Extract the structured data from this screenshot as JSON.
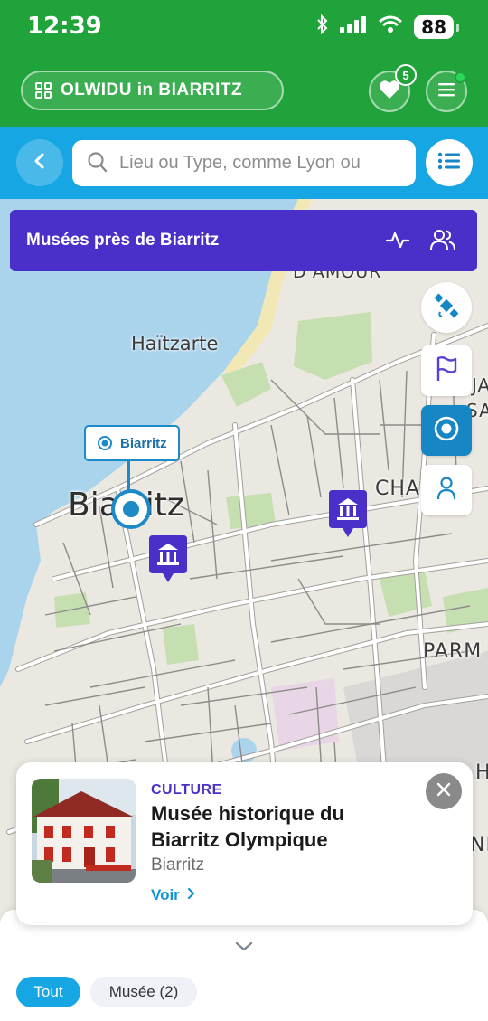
{
  "status_bar": {
    "time": "12:39",
    "battery": "88"
  },
  "header": {
    "brand": "OLWIDU in BIARRITZ",
    "favorites_count": "5"
  },
  "search": {
    "placeholder": "Lieu ou Type, comme Lyon ou"
  },
  "results_banner": {
    "title": "Musées près de Biarritz"
  },
  "map": {
    "labels": {
      "quarter_top": "D'AMOUR",
      "haitzarte": "Haïtzarte",
      "city": "Biarritz",
      "cha": "CHA",
      "parm": "PARM",
      "right_ja": "JA",
      "right_sant": "SANT",
      "right_h": "H",
      "right_nd": "ND"
    },
    "location_tag": "Biarritz",
    "water_color": "#a9d4ec",
    "land_color": "#ebe8e1",
    "park_color": "#c6dfb1"
  },
  "detail_card": {
    "category": "CULTURE",
    "title": "Musée historique du Biarritz Olympique",
    "city": "Biarritz",
    "link": "Voir"
  },
  "filters": {
    "all": "Tout",
    "museum": "Musée (2)"
  },
  "colors": {
    "green": "#21a33b",
    "blue": "#16a6e3",
    "purple": "#4b2fc9"
  }
}
